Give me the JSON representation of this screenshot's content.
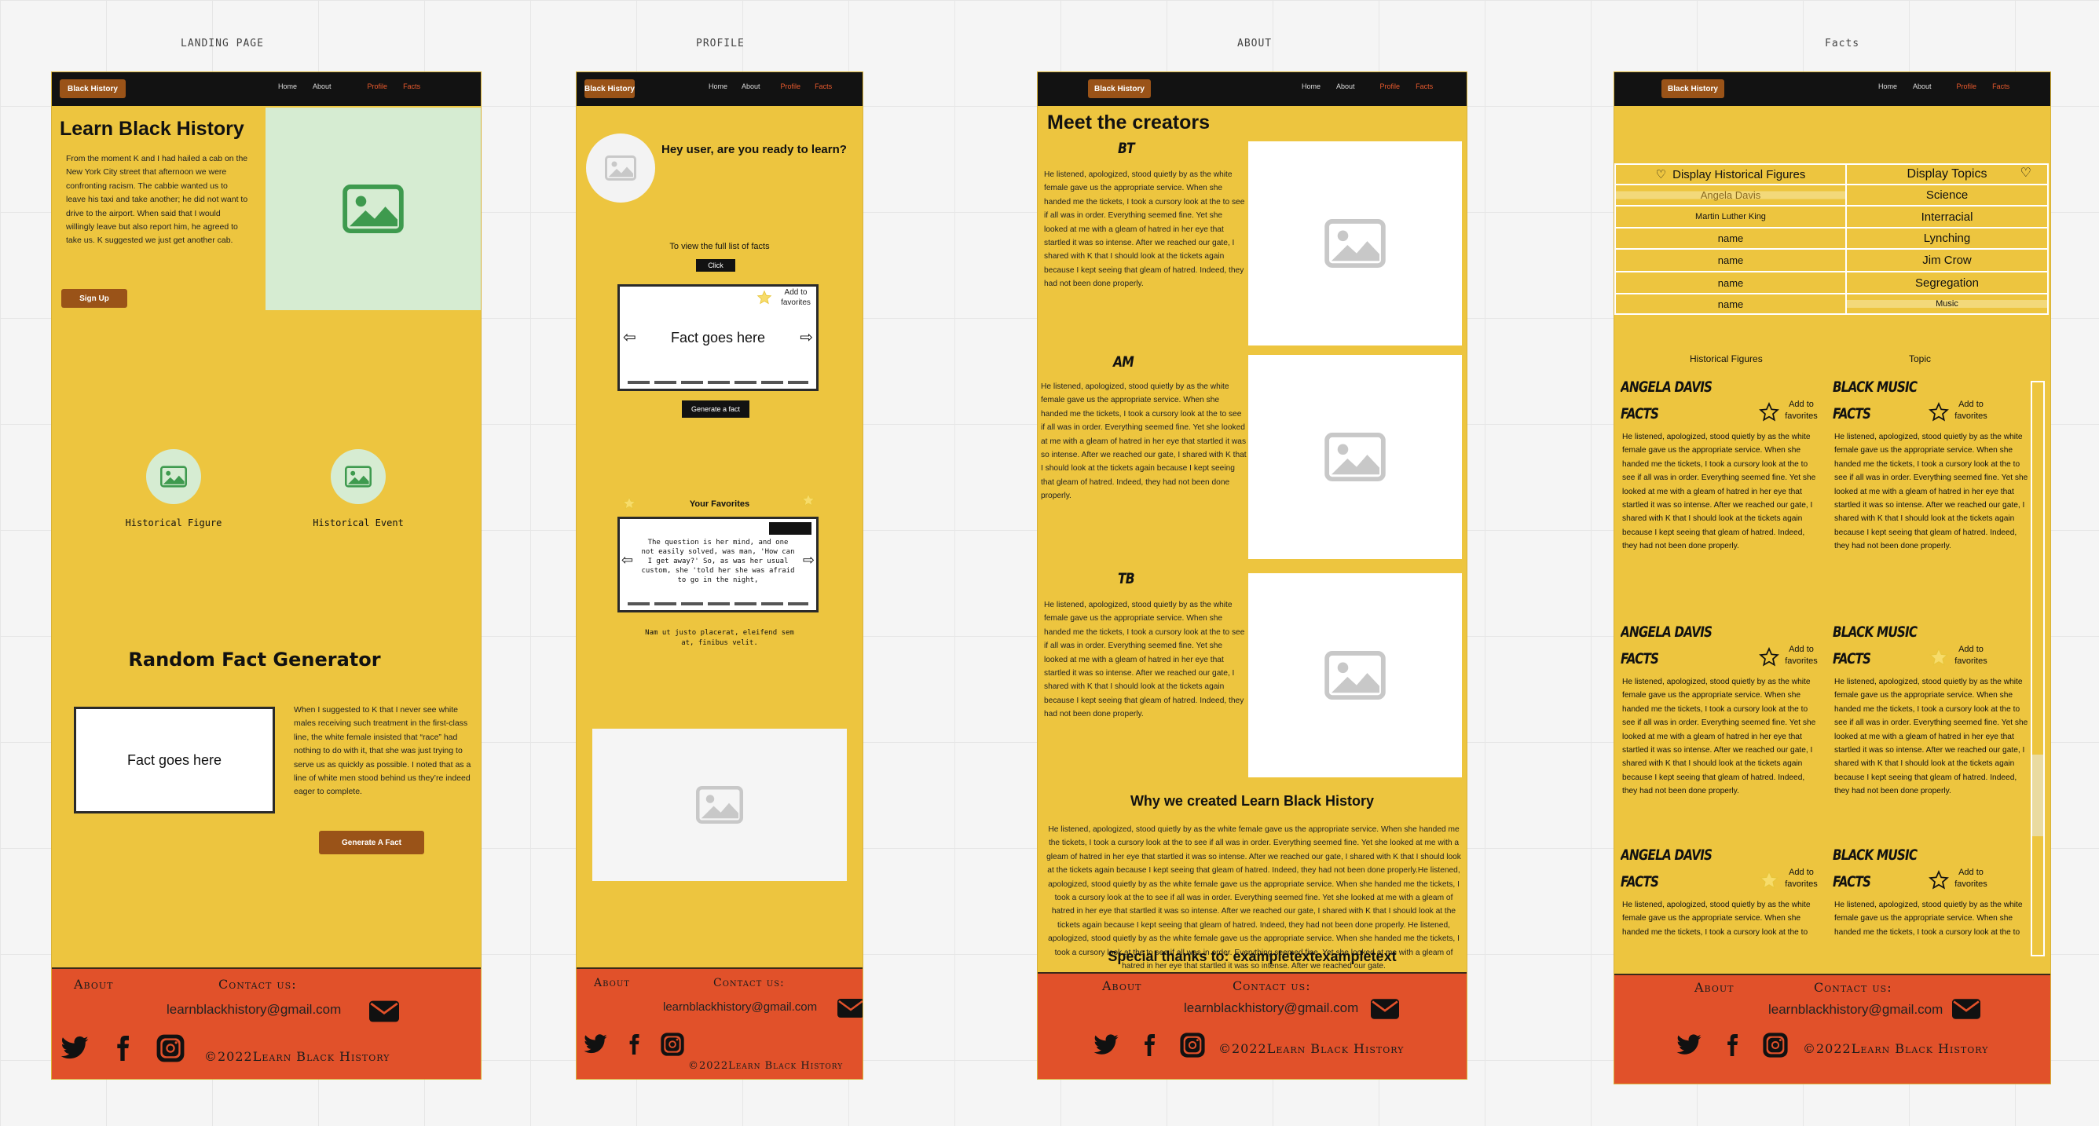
{
  "labels": {
    "landing": "LANDING PAGE",
    "profile": "PROFILE",
    "about": "ABOUT",
    "facts": "Facts"
  },
  "nav": {
    "logo": "Black History",
    "home": "Home",
    "about": "About",
    "profile": "Profile",
    "facts": "Facts"
  },
  "footer": {
    "about": "About",
    "contact": "Contact us:",
    "email": "learnblackhistory@gmail.com",
    "copyright": "©2022Learn Black History"
  },
  "landing": {
    "title": "Learn Black History",
    "intro": "From the moment K and I had hailed a cab on the New York City street that afternoon we were confronting racism. The cabbie wanted us to leave his taxi and take another; he did not want to drive to the airport. When said that I would willingly leave but also report him, he agreed to take us. K suggested we just get another cab.",
    "signup_button": "Sign Up",
    "figure_label": "Historical Figure",
    "event_label": "Historical Event",
    "generator_title": "Random Fact Generator",
    "fact_placeholder": "Fact goes here",
    "generator_text": "When I suggested to K that I never see white males receiving such treatment in the first-class line, the white female insisted that “race” had nothing to do with it, that she was just trying to serve us as quickly as possible. I noted that as a line of white men stood behind us they’re indeed eager to complete.",
    "generate_button": "Generate A Fact"
  },
  "profile": {
    "greeting": "Hey user, are you ready to learn?",
    "view_text": "To view the full list of facts",
    "click_button": "Click",
    "add_to_favorites": "Add to favorites",
    "fact_placeholder": "Fact goes here",
    "generate_button": "Generate a fact",
    "favorites_title": "Your Favorites",
    "favorite_text": "The question is her mind, and one not easily solved, was man, 'How can I get away?' So, as was her usual custom, she 'told her she was afraid to go in the night,",
    "caption": "Nam ut justo placerat, eleifend sem at, finibus velit."
  },
  "about": {
    "title": "Meet the creators",
    "creators": [
      {
        "initials": "BT",
        "bio": "He listened, apologized, stood quietly by as the white female gave us the appropriate service. When she handed me the tickets, I took a cursory look at the to see if all was in order. Everything seemed fine. Yet she looked at me with a gleam of hatred in her eye that startled it was so intense. After we reached our gate, I shared with K that I should look at the tickets again because I kept seeing that gleam of hatred. Indeed, they had not been done properly."
      },
      {
        "initials": "AM",
        "bio": "He listened, apologized, stood quietly by as the white female gave us the appropriate service. When she handed me the tickets, I took a cursory look at the to see if all was in order. Everything seemed fine. Yet she looked at me with a gleam of hatred in her eye that startled it was so intense. After we reached our gate, I shared with K that I should look at the tickets again because I kept seeing that gleam of hatred. Indeed, they had not been done properly."
      },
      {
        "initials": "TB",
        "bio": "He listened, apologized, stood quietly by as the white female gave us the appropriate service. When she handed me the tickets, I took a cursory look at the to see if all was in order. Everything seemed fine. Yet she looked at me with a gleam of hatred in her eye that startled it was so intense. After we reached our gate, I shared with K that I should look at the tickets again because I kept seeing that gleam of hatred. Indeed, they had not been done properly."
      }
    ],
    "why_title": "Why we created Learn Black History",
    "why_text": "He listened, apologized, stood quietly by as the white female gave us the appropriate service. When she handed me the tickets, I took a cursory look at the to see if all was in order. Everything seemed fine. Yet she looked at me with a gleam of hatred in her eye that startled it was so intense. After we reached our gate, I shared with K that I should look at the tickets again because I kept seeing that gleam of hatred. Indeed, they had not been done properly.He listened, apologized, stood quietly by as the white female gave us the appropriate service. When she handed me the tickets, I took a cursory look at the to see if all was in order. Everything seemed fine. Yet she looked at me with a gleam of hatred in her eye that startled it was so intense. After we reached our gate, I shared with K that I should look at the tickets again because I kept seeing that gleam of hatred. Indeed, they had not been done properly. He listened, apologized, stood quietly by as the white female gave us the appropriate service. When she handed me the tickets, I took a cursory look at the to see if all was in order. Everything seemed fine. Yet she looked at me with a gleam of hatred in her eye that startled it was so intense. After we reached our gate.",
    "thanks": "Special thanks to: exampletextexampletext"
  },
  "facts": {
    "dropdown_figures": "Display Historical Figures",
    "dropdown_topics": "Display Topics",
    "figures": [
      "Angela Davis",
      "Martin Luther King",
      "name",
      "name",
      "name",
      "name"
    ],
    "topics": [
      "Science",
      "Interracial",
      "Lynching",
      "Jim Crow",
      "Segregation",
      "Music"
    ],
    "col_figures": "Historical Figures",
    "col_topic": "Topic",
    "left_title_1": "ANGELA DAVIS",
    "left_title_2": "FACTS",
    "right_title_1": "BLACK MUSIC",
    "right_title_2": "FACTS",
    "add_to_favorites": "Add to favorites",
    "card_text": "He listened, apologized, stood quietly by as the white female gave us the appropriate service. When she handed me the tickets, I took a cursory look at the to see if all was in order. Everything seemed fine. Yet she looked at me with a gleam of hatred in her eye that startled it was so intense. After we reached our gate, I shared with K that I should look at the tickets again because I kept seeing that gleam of hatred. Indeed, they had not been done properly."
  },
  "colors": {
    "page_bg": "#edc53f",
    "footer_bg": "#e1512a",
    "topbar": "#121212",
    "button": "#9a5318",
    "hero_image_bg": "#d6ecd2"
  },
  "icons": [
    "image-icon",
    "twitter-icon",
    "facebook-icon",
    "instagram-icon",
    "mail-icon",
    "star-icon",
    "left-arrow-icon",
    "right-arrow-icon",
    "heart-icon",
    "chevron-down-icon"
  ]
}
